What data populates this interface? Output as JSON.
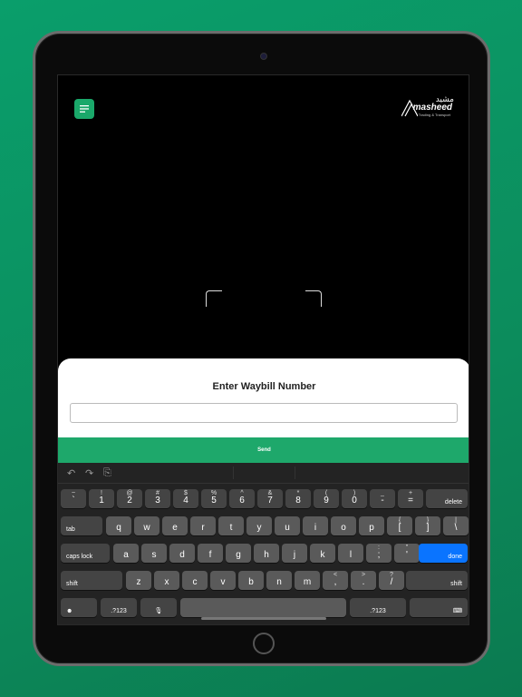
{
  "app": {
    "logo_name": "masheed",
    "logo_arabic": "مشيد",
    "logo_tagline": "Trading & Transport"
  },
  "sheet": {
    "title": "Enter Waybill Number",
    "input_value": "",
    "send_label": "Send"
  },
  "keyboard": {
    "row1": [
      {
        "top": "~",
        "main": "`"
      },
      {
        "top": "!",
        "main": "1"
      },
      {
        "top": "@",
        "main": "2"
      },
      {
        "top": "#",
        "main": "3"
      },
      {
        "top": "$",
        "main": "4"
      },
      {
        "top": "%",
        "main": "5"
      },
      {
        "top": "^",
        "main": "6"
      },
      {
        "top": "&",
        "main": "7"
      },
      {
        "top": "*",
        "main": "8"
      },
      {
        "top": "(",
        "main": "9"
      },
      {
        "top": ")",
        "main": "0"
      },
      {
        "top": "_",
        "main": "-"
      },
      {
        "top": "+",
        "main": "="
      }
    ],
    "delete_label": "delete",
    "tab_label": "tab",
    "row2": [
      "q",
      "w",
      "e",
      "r",
      "t",
      "y",
      "u",
      "i",
      "o",
      "p"
    ],
    "row2_sym": [
      {
        "top": "{",
        "main": "["
      },
      {
        "top": "}",
        "main": "]"
      },
      {
        "top": "|",
        "main": "\\"
      }
    ],
    "caps_label": "caps lock",
    "row3": [
      "a",
      "s",
      "d",
      "f",
      "g",
      "h",
      "j",
      "k",
      "l"
    ],
    "row3_sym": [
      {
        "top": ":",
        "main": ";"
      },
      {
        "top": "\"",
        "main": "'"
      }
    ],
    "done_label": "done",
    "shift_label": "shift",
    "row4": [
      "z",
      "x",
      "c",
      "v",
      "b",
      "n",
      "m"
    ],
    "row4_sym": [
      {
        "top": "<",
        "main": ","
      },
      {
        "top": ">",
        "main": "."
      },
      {
        "top": "?",
        "main": "/"
      }
    ],
    "numbers_label": ".?123",
    "emoji_icon": "emoji-icon",
    "mic_icon": "microphone-icon",
    "hide_icon": "keyboard-hide-icon"
  }
}
